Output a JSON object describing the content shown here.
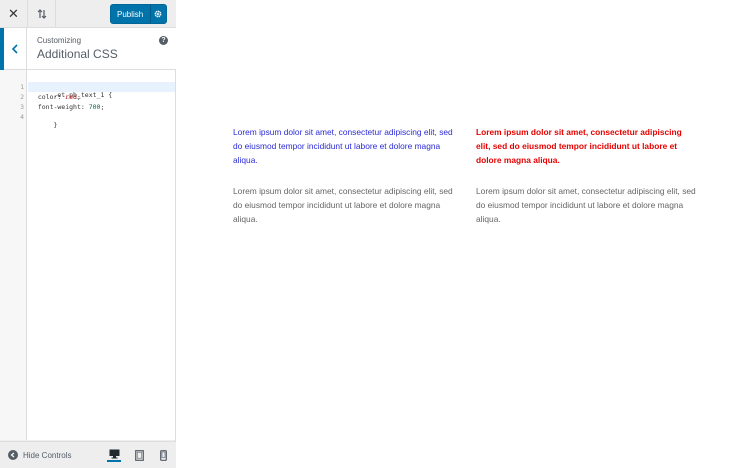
{
  "topbar": {
    "publish_label": "Publish"
  },
  "section": {
    "breadcrumb": "Customizing",
    "title": "Additional CSS",
    "help_glyph": "?"
  },
  "editor": {
    "line_numbers": [
      "1",
      "2",
      "3",
      "4"
    ],
    "lines": {
      "l1": ".et_pb_text_1 {",
      "l2_prop": "  color: ",
      "l2_val": "red",
      "l2_end": ";",
      "l3_prop": "  font-weight: ",
      "l3_val": "700",
      "l3_end": ";",
      "l4": "}"
    }
  },
  "bottombar": {
    "hide_controls_label": "Hide Controls"
  },
  "preview": {
    "col1_para1": "Lorem ipsum dolor sit amet, consectetur adipiscing elit, sed do eiusmod tempor incididunt ut labore et dolore magna aliqua.",
    "col2_para1": "Lorem ipsum dolor sit amet, consectetur adipiscing elit, sed do eiusmod tempor incididunt ut labore et dolore magna aliqua.",
    "col1_para2": "Lorem ipsum dolor sit amet, consectetur adipiscing elit, sed do eiusmod tempor incididunt ut labore et dolore magna aliqua.",
    "col2_para2": "Lorem ipsum dolor sit amet, consectetur adipiscing elit, sed do eiusmod tempor incididunt ut labore et dolore magna aliqua."
  },
  "colors": {
    "accent": "#0073aa",
    "col1_heading_text": "#2b2bd6",
    "col2_heading_text": "#e60000",
    "body_text": "#666666"
  },
  "icons": {
    "close": "close-icon",
    "sort": "sort-arrows-icon",
    "publish_settings": "gear-icon",
    "back": "chevron-left-icon",
    "help": "help-icon",
    "hide_controls": "arrow-left-circle-icon",
    "desktop": "desktop-icon",
    "tablet": "tablet-icon",
    "mobile": "mobile-icon"
  }
}
